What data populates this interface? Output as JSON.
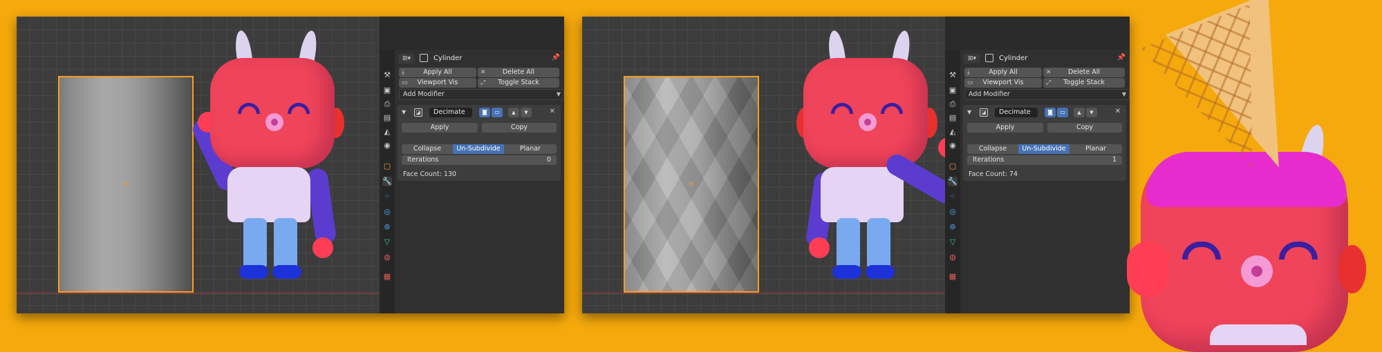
{
  "panels": [
    {
      "object_name": "Cylinder",
      "apply_all": "Apply All",
      "delete_all": "Delete All",
      "viewport_vis": "Viewport Vis",
      "toggle_stack": "Toggle Stack",
      "add_modifier": "Add Modifier",
      "modifier_name": "Decimate",
      "apply": "Apply",
      "copy": "Copy",
      "mode_collapse": "Collapse",
      "mode_unsubdivide": "Un-Subdivide",
      "mode_planar": "Planar",
      "active_mode": "Un-Subdivide",
      "iterations_label": "Iterations",
      "iterations_value": "0",
      "face_count": "Face Count: 130"
    },
    {
      "object_name": "Cylinder",
      "apply_all": "Apply All",
      "delete_all": "Delete All",
      "viewport_vis": "Viewport Vis",
      "toggle_stack": "Toggle Stack",
      "add_modifier": "Add Modifier",
      "modifier_name": "Decimate",
      "apply": "Apply",
      "copy": "Copy",
      "mode_collapse": "Collapse",
      "mode_unsubdivide": "Un-Subdivide",
      "mode_planar": "Planar",
      "active_mode": "Un-Subdivide",
      "iterations_label": "Iterations",
      "iterations_value": "1",
      "face_count": "Face Count: 74"
    }
  ],
  "colors": {
    "background": "#f5a90c",
    "selection_outline": "#ff9d1c",
    "active_button": "#4772b3"
  }
}
